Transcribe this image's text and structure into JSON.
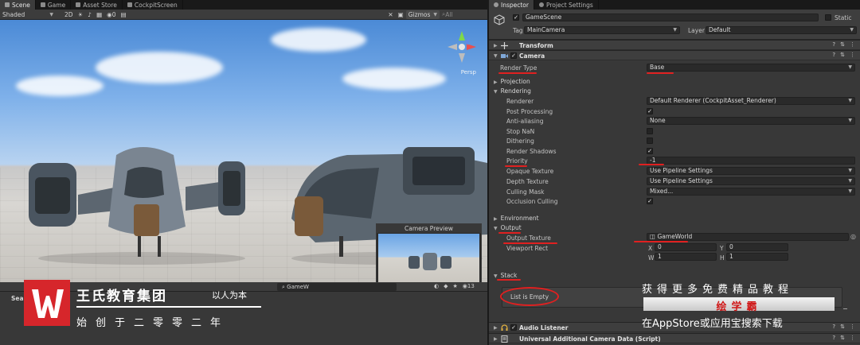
{
  "scene": {
    "tabs": [
      {
        "label": "Scene",
        "icon": "hash-icon",
        "color": "#9a9a9a"
      },
      {
        "label": "Game",
        "icon": "game-icon",
        "color": "#9a9a9a"
      },
      {
        "label": "Asset Store",
        "icon": "store-icon",
        "color": "#9a9a9a"
      },
      {
        "label": "CockpitScreen",
        "icon": "screen-icon",
        "color": "#9a9a9a"
      }
    ],
    "toolbar": {
      "shading": "Shaded",
      "mode_2d": "2D",
      "gizmos": "Gizmos",
      "search": "All",
      "hidden_count": "0"
    },
    "persp": "Persp",
    "camera_preview_title": "Camera Preview"
  },
  "project": {
    "search_value": "GameW",
    "hidden_count": "13",
    "left_label": "Sear",
    "left_label2": "..."
  },
  "brand": {
    "title": "王氏教育集团",
    "subtitle": "以人为本",
    "founded": "始创于二零零二年"
  },
  "inspector": {
    "tabs": [
      {
        "label": "Inspector"
      },
      {
        "label": "Project Settings"
      }
    ],
    "object_name": "GameScene",
    "static_label": "Static",
    "tag_label": "Tag",
    "tag_value": "MainCamera",
    "layer_label": "Layer",
    "layer_value": "Default",
    "components": {
      "transform": "Transform",
      "camera": "Camera",
      "audio_listener": "Audio Listener",
      "universal_data": "Universal Additional Camera Data (Script)"
    },
    "render_type_label": "Render Type",
    "render_type_value": "Base",
    "projection": "Projection",
    "rendering": "Rendering",
    "rows": [
      {
        "label": "Renderer",
        "value": "Default Renderer (CockpitAsset_Renderer)",
        "kind": "dropdown"
      },
      {
        "label": "Post Processing",
        "value": "✓",
        "kind": "check"
      },
      {
        "label": "Anti-aliasing",
        "value": "None",
        "kind": "dropdown"
      },
      {
        "label": "Stop NaN",
        "value": "",
        "kind": "check"
      },
      {
        "label": "Dithering",
        "value": "",
        "kind": "check"
      },
      {
        "label": "Render Shadows",
        "value": "✓",
        "kind": "check"
      },
      {
        "label": "Priority",
        "value": "-1",
        "kind": "text"
      },
      {
        "label": "Opaque Texture",
        "value": "Use Pipeline Settings",
        "kind": "dropdown"
      },
      {
        "label": "Depth Texture",
        "value": "Use Pipeline Settings",
        "kind": "dropdown"
      },
      {
        "label": "Culling Mask",
        "value": "Mixed...",
        "kind": "dropdown"
      },
      {
        "label": "Occlusion Culling",
        "value": "✓",
        "kind": "check"
      }
    ],
    "environment": "Environment",
    "output": "Output",
    "output_texture_label": "Output Texture",
    "output_texture_value": "GameWorld",
    "viewport_label": "Viewport Rect",
    "viewport": {
      "x_label": "X",
      "x": "0",
      "y_label": "Y",
      "y": "0",
      "w_label": "W",
      "w": "1",
      "h_label": "H",
      "h": "1"
    },
    "stack": "Stack",
    "list_empty": "List is Empty"
  },
  "promo": {
    "line1": "获得更多免费精品教程",
    "bar": "绘学霸",
    "line3": "在AppStore或应用宝搜索下载"
  },
  "colors": {
    "accent_red": "#e02020",
    "brand_red": "#d6262b"
  }
}
